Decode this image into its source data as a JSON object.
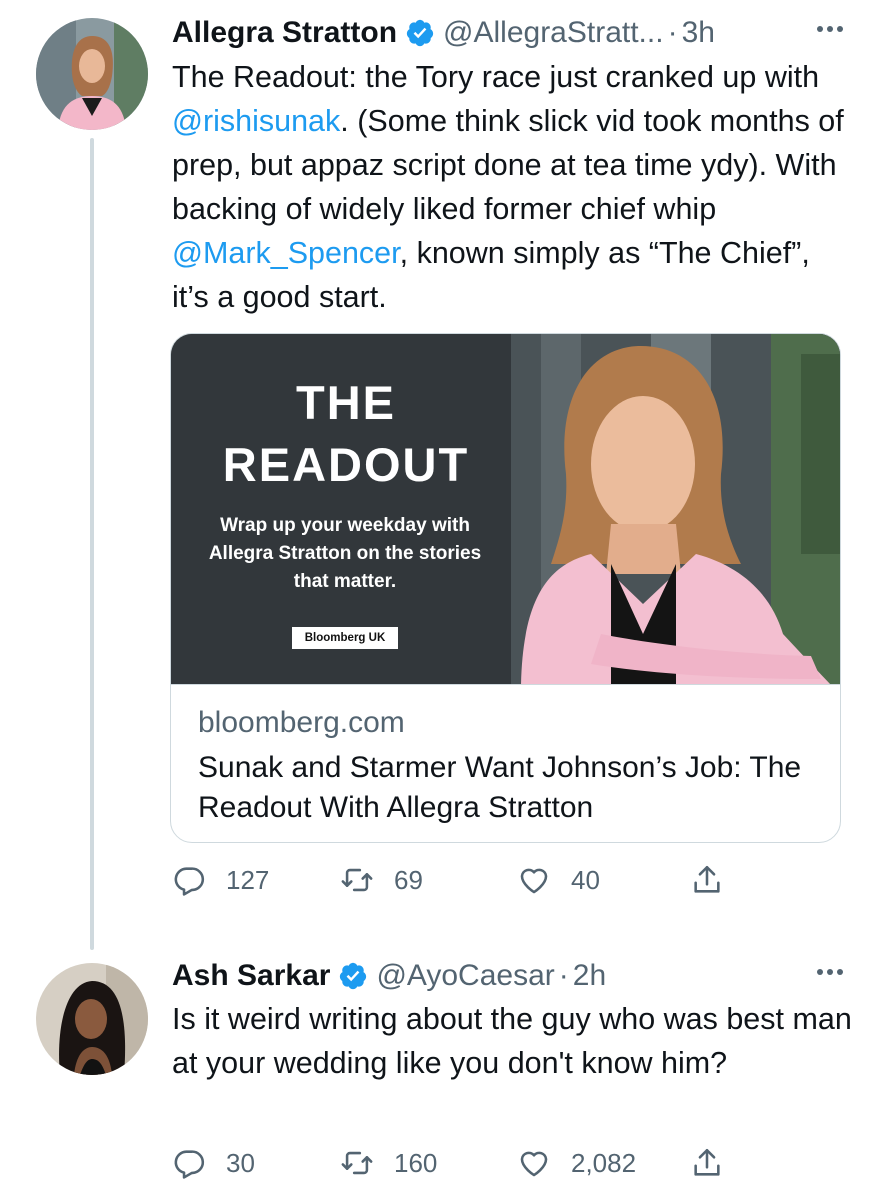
{
  "tweets": [
    {
      "name": "Allegra Stratton",
      "handle": "@AllegraStratt...",
      "dot": "·",
      "time": "3h",
      "text_parts": {
        "p1": "The Readout: the Tory race just cranked up with ",
        "m1": "@rishisunak",
        "p2": ". (Some think slick vid took months of prep, but appaz script done at tea time ydy). With backing of widely liked former chief whip ",
        "m2": "@Mark_Spencer",
        "p3": ", known simply as “The Chief”, it’s a good start."
      },
      "card": {
        "image_title_1": "THE",
        "image_title_2": "READOUT",
        "image_sub": "Wrap up your weekday with Allegra Stratton on the stories that matter.",
        "image_badge": "Bloomberg UK",
        "domain": "bloomberg.com",
        "title": "Sunak and Starmer Want Johnson’s Job: The Readout With Allegra Stratton"
      },
      "counts": {
        "replies": "127",
        "retweets": "69",
        "likes": "40"
      }
    },
    {
      "name": "Ash Sarkar",
      "handle": "@AyoCaesar",
      "dot": "·",
      "time": "2h",
      "text": "Is it weird writing about the guy who was best man at your wedding like you don't know him?",
      "counts": {
        "replies": "30",
        "retweets": "160",
        "likes": "2,082"
      }
    }
  ],
  "icons": {
    "verified": "verified-badge-icon",
    "more": "more-dots-icon",
    "reply": "reply-bubble-icon",
    "retweet": "retweet-arrows-icon",
    "like": "heart-icon",
    "share": "share-upload-icon"
  },
  "colors": {
    "accent": "#1d9bf0",
    "text": "#0f1419",
    "secondary": "#536471",
    "border": "#cfd9de"
  }
}
